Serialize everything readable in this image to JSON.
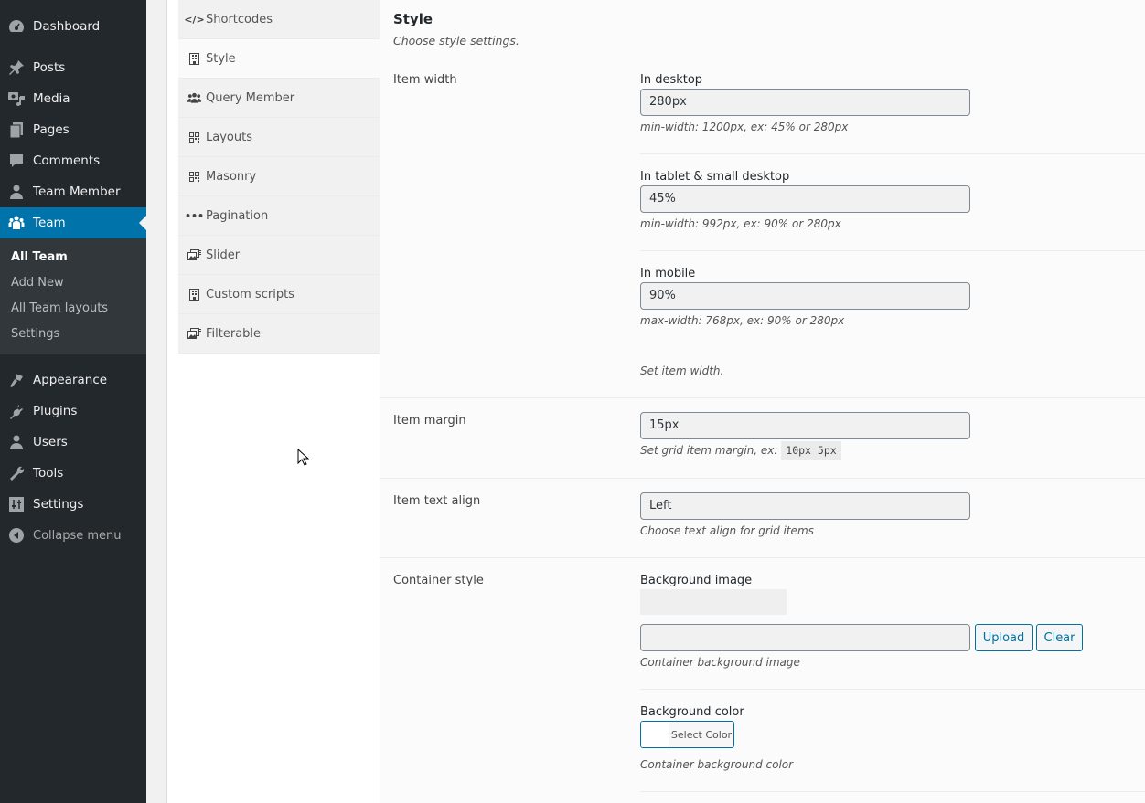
{
  "admin_menu": {
    "items": [
      {
        "label": "Dashboard",
        "icon": "dashboard-icon"
      },
      {
        "label": "Posts",
        "icon": "pin-icon"
      },
      {
        "label": "Media",
        "icon": "media-icon"
      },
      {
        "label": "Pages",
        "icon": "pages-icon"
      },
      {
        "label": "Comments",
        "icon": "comment-icon"
      },
      {
        "label": "Team Member",
        "icon": "person-icon"
      },
      {
        "label": "Team",
        "icon": "group-icon",
        "active": true
      }
    ],
    "submenu": [
      "All Team",
      "Add New",
      "All Team layouts",
      "Settings"
    ],
    "items_after": [
      {
        "label": "Appearance",
        "icon": "paintbrush-icon"
      },
      {
        "label": "Plugins",
        "icon": "plugin-icon"
      },
      {
        "label": "Users",
        "icon": "users-icon"
      },
      {
        "label": "Tools",
        "icon": "wrench-icon"
      },
      {
        "label": "Settings",
        "icon": "settings-sliders-icon"
      }
    ],
    "collapse_label": "Collapse menu"
  },
  "tabs": [
    {
      "label": "Shortcodes",
      "icon": "code-icon"
    },
    {
      "label": "Style",
      "icon": "building-icon",
      "active": true
    },
    {
      "label": "Query Member",
      "icon": "users-icon"
    },
    {
      "label": "Layouts",
      "icon": "qrcode-icon"
    },
    {
      "label": "Masonry",
      "icon": "qrcode-icon"
    },
    {
      "label": "Pagination",
      "icon": "ellipsis-icon"
    },
    {
      "label": "Slider",
      "icon": "images-icon"
    },
    {
      "label": "Custom scripts",
      "icon": "building-icon"
    },
    {
      "label": "Filterable",
      "icon": "images-icon"
    }
  ],
  "section": {
    "title": "Style",
    "description": "Choose style settings."
  },
  "item_width": {
    "label": "Item width",
    "desktop": {
      "label": "In desktop",
      "value": "280px",
      "hint": "min-width: 1200px, ex: 45% or 280px"
    },
    "tablet": {
      "label": "In tablet & small desktop",
      "value": "45%",
      "hint": "min-width: 992px, ex: 90% or 280px"
    },
    "mobile": {
      "label": "In mobile",
      "value": "90%",
      "hint": "max-width: 768px, ex: 90% or 280px"
    },
    "description": "Set item width."
  },
  "item_margin": {
    "label": "Item margin",
    "value": "15px",
    "hint": "Set grid item margin, ex:",
    "example": "10px 5px"
  },
  "item_text_align": {
    "label": "Item text align",
    "value": "Left",
    "hint": "Choose text align for grid items"
  },
  "container_style": {
    "label": "Container style",
    "bg_image": {
      "label": "Background image",
      "value": "",
      "upload_label": "Upload",
      "clear_label": "Clear",
      "hint": "Container background image"
    },
    "bg_color": {
      "label": "Background color",
      "button_label": "Select Color",
      "hint": "Container background color"
    }
  },
  "colors": {
    "accent": "#0073aa",
    "sidebar": "#23282d",
    "button": "#0071a1"
  }
}
